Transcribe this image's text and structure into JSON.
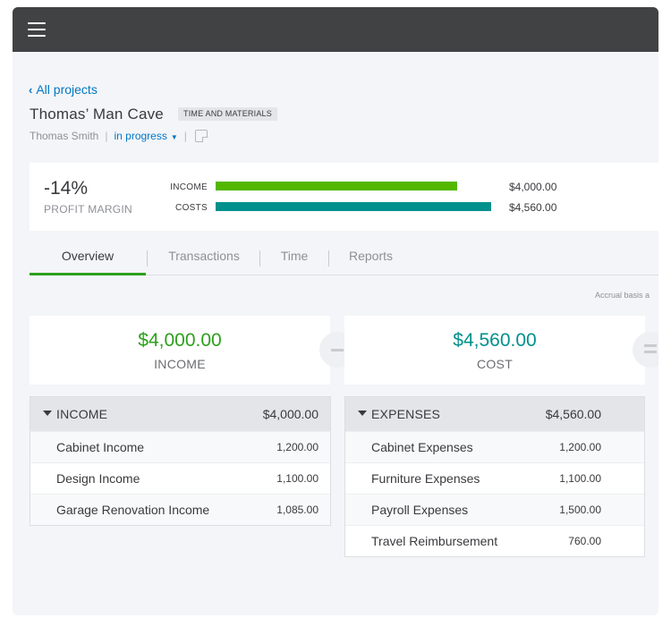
{
  "colors": {
    "accent_green": "#2ca01c",
    "income_bar": "#53b700",
    "cost_bar": "#00908c",
    "link_blue": "#0077c5",
    "topbar": "#404244"
  },
  "header": {
    "menu_icon": "hamburger-icon"
  },
  "nav": {
    "back_label": "All projects"
  },
  "project": {
    "title": "Thomas’ Man Cave",
    "type_badge": "TIME AND MATERIALS",
    "customer": "Thomas Smith",
    "status": "in progress"
  },
  "summary": {
    "profit_margin_value": "-14%",
    "profit_margin_label": "PROFIT MARGIN",
    "income_label": "INCOME",
    "income_amount": "$4,000.00",
    "income_value": 4000,
    "costs_label": "COSTS",
    "costs_amount": "$4,560.00",
    "costs_value": 4560
  },
  "tabs": [
    {
      "label": "Overview",
      "active": true
    },
    {
      "label": "Transactions",
      "active": false
    },
    {
      "label": "Time",
      "active": false
    },
    {
      "label": "Reports",
      "active": false
    }
  ],
  "basis_label": "Accrual basis a",
  "cards": {
    "income": {
      "amount": "$4,000.00",
      "label": "INCOME"
    },
    "cost": {
      "amount": "$4,560.00",
      "label": "COST"
    }
  },
  "income_table": {
    "title": "INCOME",
    "total": "$4,000.00",
    "rows": [
      {
        "name": "Cabinet Income",
        "value": "1,200.00"
      },
      {
        "name": "Design Income",
        "value": "1,100.00"
      },
      {
        "name": "Garage Renovation Income",
        "value": "1,085.00"
      }
    ]
  },
  "expenses_table": {
    "title": "EXPENSES",
    "total": "$4,560.00",
    "rows": [
      {
        "name": "Cabinet Expenses",
        "value": "1,200.00"
      },
      {
        "name": "Furniture Expenses",
        "value": "1,100.00"
      },
      {
        "name": "Payroll Expenses",
        "value": "1,500.00"
      },
      {
        "name": "Travel Reimbursement",
        "value": "760.00"
      }
    ]
  }
}
